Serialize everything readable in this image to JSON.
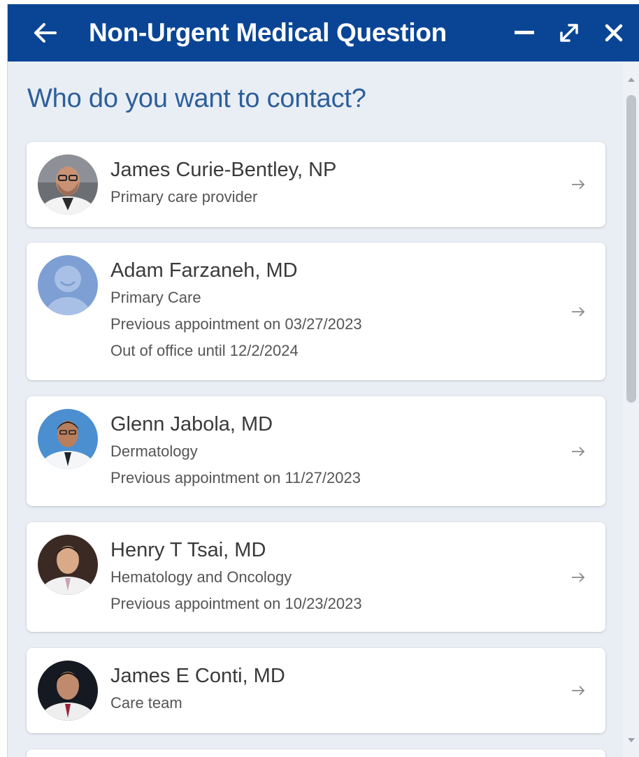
{
  "window": {
    "title": "Non-Urgent Medical Question"
  },
  "icons": {
    "back": "back-arrow-icon",
    "minimize": "minimize-icon",
    "expand": "expand-icon",
    "close": "close-icon"
  },
  "prompt": "Who do you want to contact?",
  "providers": [
    {
      "name": "James Curie-Bentley, NP",
      "details": [
        "Primary care provider"
      ]
    },
    {
      "name": "Adam Farzaneh, MD",
      "details": [
        "Primary Care",
        "Previous appointment on 03/27/2023",
        "Out of office until 12/2/2024"
      ]
    },
    {
      "name": "Glenn Jabola, MD",
      "details": [
        "Dermatology",
        "Previous appointment on 11/27/2023"
      ]
    },
    {
      "name": "Henry T Tsai, MD",
      "details": [
        "Hematology and Oncology",
        "Previous appointment on 10/23/2023"
      ]
    },
    {
      "name": "James E Conti, MD",
      "details": [
        "Care team"
      ]
    }
  ],
  "colors": {
    "titlebar": "#0a4595",
    "heading": "#2d5f9a",
    "background": "#e9eef5"
  }
}
